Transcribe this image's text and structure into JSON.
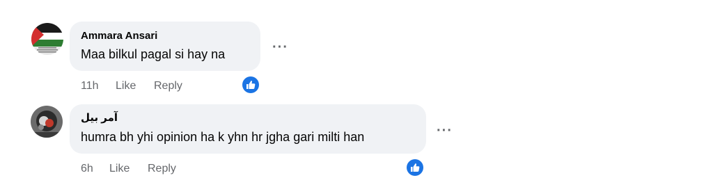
{
  "comments": [
    {
      "author": "Ammara Ansari",
      "text": "Maa bilkul pagal si hay na",
      "avatar_text": "I STAND WITH PALESTINE",
      "time": "11h",
      "like_label": "Like",
      "reply_label": "Reply",
      "more_label": "···"
    },
    {
      "author": "آمر بیل",
      "text": "humra bh yhi opinion ha k yhn hr jgha gari milti han",
      "time": "6h",
      "like_label": "Like",
      "reply_label": "Reply",
      "more_label": "···"
    }
  ],
  "colors": {
    "bubble": "#f0f2f5",
    "meta_text": "#65676b",
    "like_blue": "#1b74e4"
  }
}
